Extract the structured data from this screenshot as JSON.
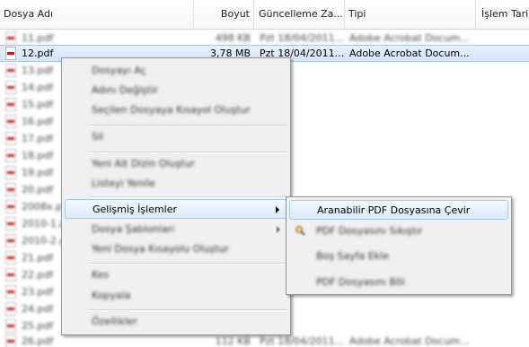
{
  "header": {
    "col_name": "Dosya Adı",
    "col_size": "Boyut",
    "col_modified": "Güncelleme Za...",
    "col_type": "Tipi",
    "col_process": "İşlem Tari"
  },
  "rows": [
    {
      "name": "11.pdf",
      "size": "498 KB",
      "modified": "Pzt 18/04/2011...",
      "type": "Adobe Acrobat Docum..."
    },
    {
      "name": "12.pdf",
      "size": "3,78 MB",
      "modified": "Pzt 18/04/2011...",
      "type": "Adobe Acrobat Docum..."
    },
    {
      "name": "13.pdf"
    },
    {
      "name": "14.pdf"
    },
    {
      "name": "15.pdf"
    },
    {
      "name": "16.pdf"
    },
    {
      "name": "17.pdf"
    },
    {
      "name": "18.pdf"
    },
    {
      "name": "19.pdf"
    },
    {
      "name": "20.pdf"
    },
    {
      "name": "2008x.pdf"
    },
    {
      "name": "2010-1.pdf"
    },
    {
      "name": "2010-2.pdf"
    },
    {
      "name": "21.pdf"
    },
    {
      "name": "22.pdf"
    },
    {
      "name": "23.pdf"
    },
    {
      "name": "24.pdf"
    },
    {
      "name": "25.pdf"
    },
    {
      "name": "26.pdf",
      "size": "112 KB",
      "modified": "Pzt 18/04/2011...",
      "type": "Adobe Acrobat Docum..."
    }
  ],
  "context_menu": {
    "items": [
      {
        "label": "Dosyayı Aç"
      },
      {
        "label": "Adını Değiştir"
      },
      {
        "label": "Seçilen Dosyaya Kısayol Oluştur"
      },
      {
        "label": "Sil"
      },
      {
        "label": "Yeni Alt Dizin Oluştur"
      },
      {
        "label": "Listeyi Yenile"
      },
      {
        "label": "Gelişmiş İşlemler"
      },
      {
        "label": "Dosya Şablonları"
      },
      {
        "label": "Yeni Dosya Kısayolu Oluştur"
      },
      {
        "label": "Kes"
      },
      {
        "label": "Kopyala"
      },
      {
        "label": "Özellikler"
      }
    ]
  },
  "submenu": {
    "items": [
      {
        "label": "Aranabilir PDF Dosyasına Çevir"
      },
      {
        "label": "PDF Dosyasını Sıkıştır"
      },
      {
        "label": "Boş Sayfa Ekle"
      },
      {
        "label": "PDF Dosyasını Böl"
      }
    ]
  },
  "icons": {
    "file": "pdf-file-icon",
    "submenu_arrow": "chevron-right-icon",
    "compress": "magnifier-icon"
  }
}
